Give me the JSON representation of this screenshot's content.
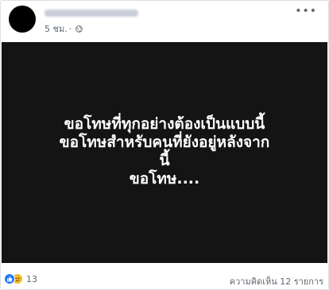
{
  "post": {
    "time": "5 ชม.",
    "privacy_icon": "globe-icon",
    "more_icon": "more-options-icon",
    "caption_lines": [
      "ขอโทษที่ทุกอย่างต้องเป็นแบบนี้",
      "ขอโทษสำหรับคนที่ยังอยู่หลังจาก",
      "นี้",
      "ขอโทษ...."
    ],
    "reactions": {
      "types": [
        "like",
        "sad"
      ],
      "count": "13"
    },
    "comments_label": "ความคิดเห็น 12 รายการ"
  },
  "colors": {
    "image_background": "#141414",
    "caption_text": "#ffffff",
    "like_blue": "#2078f4",
    "sad_yellow": "#f7b928",
    "meta_gray": "#606770"
  }
}
